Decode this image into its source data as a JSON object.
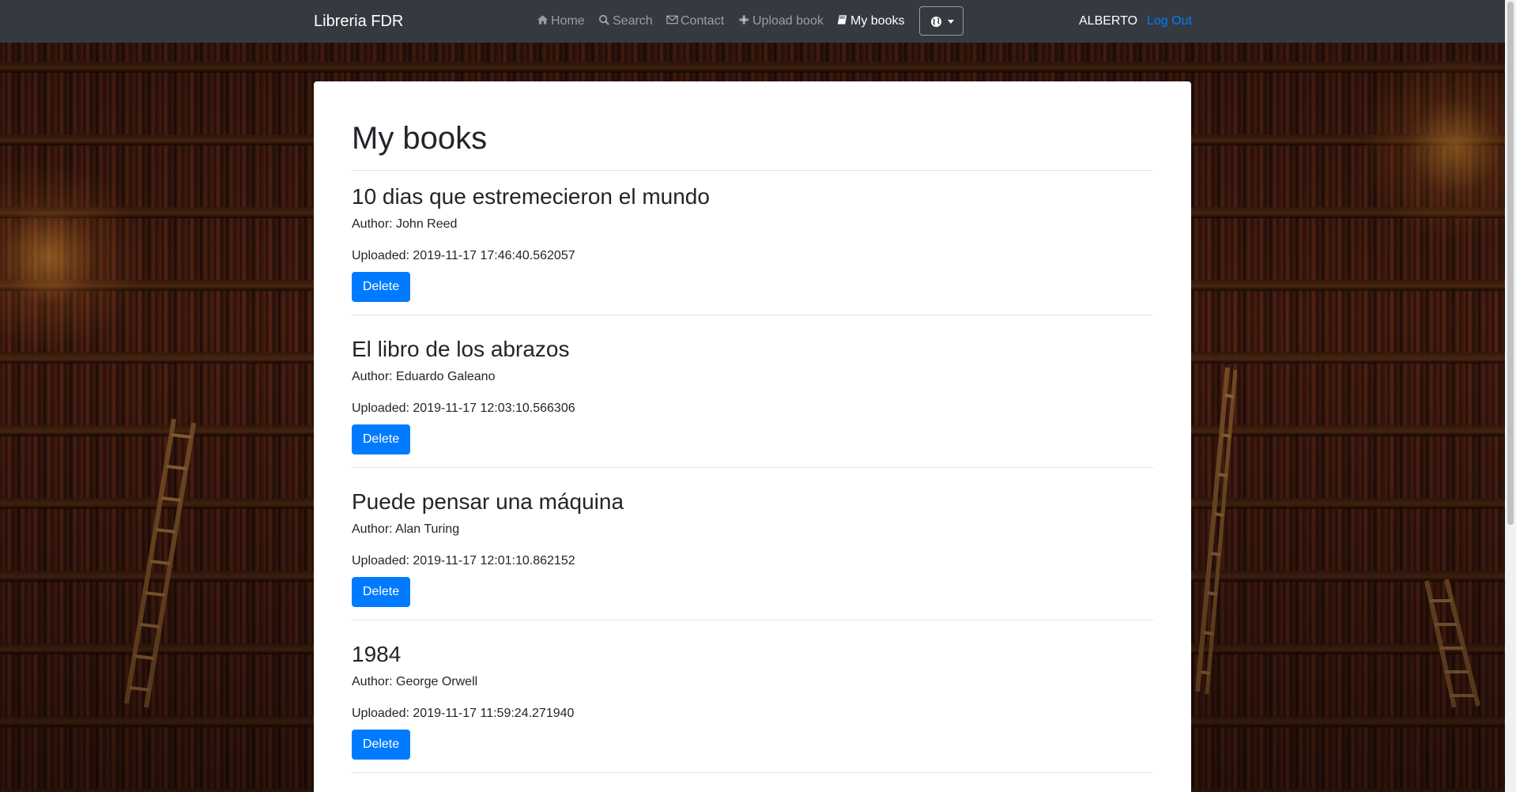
{
  "navbar": {
    "brand": "Libreria FDR",
    "items": [
      {
        "label": "Home",
        "icon": "home-icon"
      },
      {
        "label": "Search",
        "icon": "search-icon"
      },
      {
        "label": "Contact",
        "icon": "envelope-icon"
      },
      {
        "label": "Upload book",
        "icon": "plus-icon"
      },
      {
        "label": "My books",
        "icon": "book-icon",
        "active": true
      }
    ],
    "language_icon": "globe-icon",
    "username": "ALBERTO",
    "logout_label": "Log Out"
  },
  "main": {
    "title": "My books",
    "books": [
      {
        "title": "10 dias que estremecieron el mundo",
        "author": "Author: John Reed",
        "uploaded": "Uploaded: 2019-11-17 17:46:40.562057",
        "delete_label": "Delete"
      },
      {
        "title": "El libro de los abrazos",
        "author": "Author: Eduardo Galeano",
        "uploaded": "Uploaded: 2019-11-17 12:03:10.566306",
        "delete_label": "Delete"
      },
      {
        "title": "Puede pensar una máquina",
        "author": "Author: Alan Turing",
        "uploaded": "Uploaded: 2019-11-17 12:01:10.862152",
        "delete_label": "Delete"
      },
      {
        "title": "1984",
        "author": "Author: George Orwell",
        "uploaded": "Uploaded: 2019-11-17 11:59:24.271940",
        "delete_label": "Delete"
      }
    ]
  },
  "colors": {
    "navbar_bg": "#343a40",
    "primary": "#007bff",
    "text": "#212529",
    "rule": "#dee2e6"
  }
}
